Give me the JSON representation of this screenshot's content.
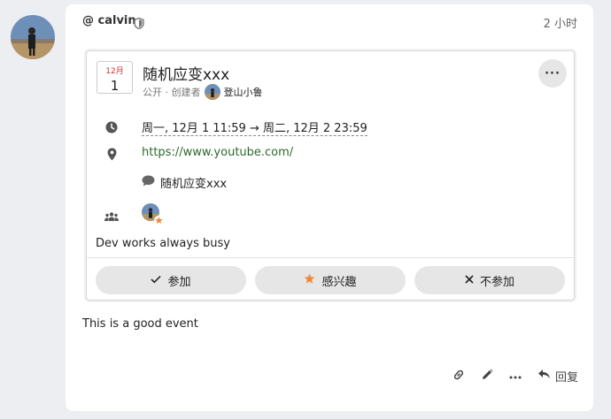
{
  "post": {
    "author": "@ calvin",
    "timestamp": "2 小时",
    "body": "This is a good event",
    "actions": {
      "reply_label": "回复"
    }
  },
  "event": {
    "month": "12月",
    "day": "1",
    "title": "随机应变xxx",
    "visibility": "公开 · 创建者",
    "creator": "登山小鲁",
    "more_label": "···",
    "date_range": "周一, 12月 1 11:59 → 周二, 12月 2 23:59",
    "link": "https://www.youtube.com/",
    "chat_label": "随机应变xxx",
    "description": "Dev works always busy",
    "rsvp": {
      "going": "参加",
      "interested": "感兴趣",
      "not_going": "不参加"
    }
  },
  "colors": {
    "month_red": "#d03030",
    "link_green": "#2d6a2d",
    "star_orange": "#f0883a"
  },
  "icons": [
    "shield-icon",
    "clock-icon",
    "map-pin-icon",
    "chat-bubble-icon",
    "group-icon",
    "star-icon",
    "check-icon",
    "close-icon",
    "link-icon",
    "pencil-icon",
    "ellipsis-icon",
    "reply-icon"
  ]
}
